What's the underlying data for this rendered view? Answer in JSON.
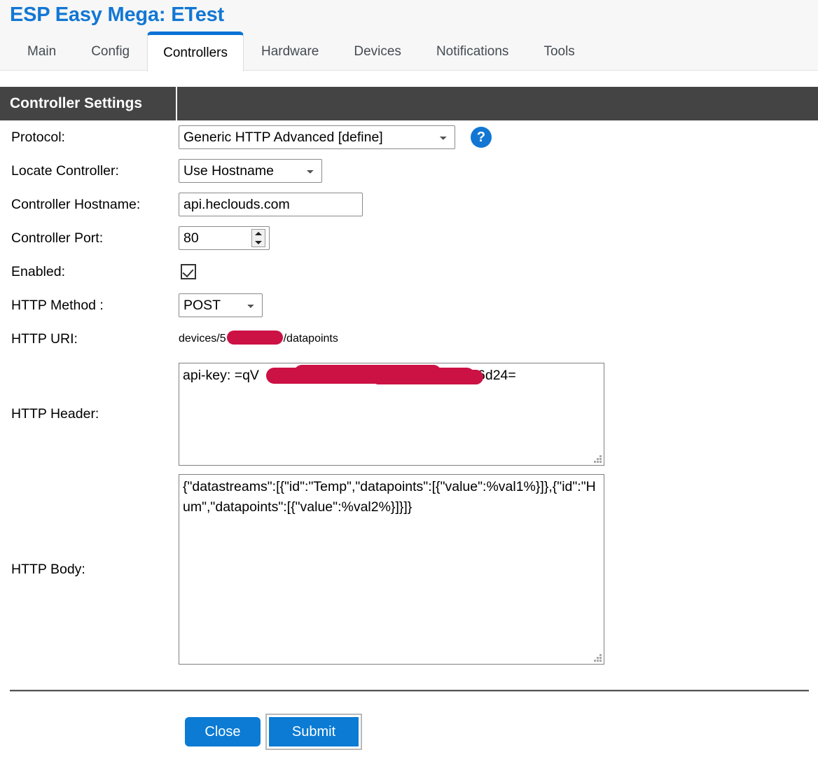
{
  "header": {
    "site_title": "ESP Easy Mega: ETest",
    "accent_color": "#1277d4",
    "tabs": [
      {
        "label": "Main",
        "active": false
      },
      {
        "label": "Config",
        "active": false
      },
      {
        "label": "Controllers",
        "active": true
      },
      {
        "label": "Hardware",
        "active": false
      },
      {
        "label": "Devices",
        "active": false
      },
      {
        "label": "Notifications",
        "active": false
      },
      {
        "label": "Tools",
        "active": false
      }
    ]
  },
  "section": {
    "title": "Controller Settings",
    "bar_color": "#444444"
  },
  "form": {
    "protocol": {
      "label": "Protocol:",
      "value": "Generic HTTP Advanced [define]",
      "help_icon": "question-mark-icon"
    },
    "locate_controller": {
      "label": "Locate Controller:",
      "value": "Use Hostname"
    },
    "controller_hostname": {
      "label": "Controller Hostname:",
      "value": "api.heclouds.com"
    },
    "controller_port": {
      "label": "Controller Port:",
      "value": "80"
    },
    "enabled": {
      "label": "Enabled:",
      "checked": true
    },
    "http_method": {
      "label": "HTTP Method :",
      "value": "POST"
    },
    "http_uri": {
      "label": "HTTP URI:",
      "value_prefix": "devices/5",
      "value_suffix": "/datapoints",
      "redacted": true
    },
    "http_header": {
      "label": "HTTP Header:",
      "value_prefix": "api-key: =qV",
      "value_suffix": "U6d24=",
      "redacted": true
    },
    "http_body": {
      "label": "HTTP Body:",
      "value": "{\"datastreams\":[{\"id\":\"Temp\",\"datapoints\":[{\"value\":%val1%}]},{\"id\":\"Hum\",\"datapoints\":[{\"value\":%val2%}]}]}"
    }
  },
  "actions": {
    "close_label": "Close",
    "submit_label": "Submit",
    "button_color": "#0b7bd4"
  },
  "redaction": {
    "color": "#cc1145"
  }
}
